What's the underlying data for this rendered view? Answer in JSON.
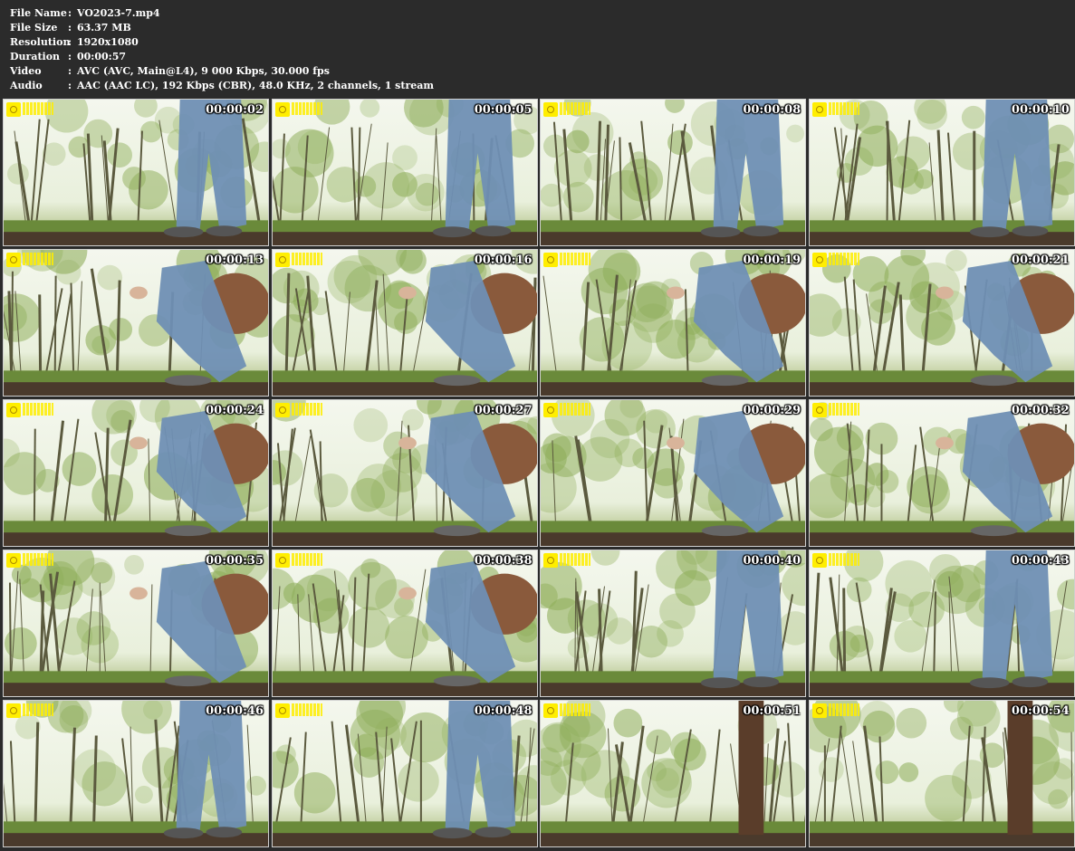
{
  "info": {
    "rows": [
      {
        "label": "File Name",
        "value": "VO2023-7.mp4"
      },
      {
        "label": "File Size",
        "value": "63.37 MB"
      },
      {
        "label": "Resolution",
        "value": "1920x1080"
      },
      {
        "label": "Duration",
        "value": "00:00:57"
      },
      {
        "label": "Video",
        "value": "AVC (AVC, Main@L4), 9 000 Kbps, 30.000 fps"
      },
      {
        "label": "Audio",
        "value": "AAC (AAC LC), 192 Kbps (CBR), 48.0 KHz, 2 channels, 1 stream"
      }
    ],
    "separator": ":"
  },
  "thumbnails": [
    {
      "time": "00:00:02",
      "scene": "standing"
    },
    {
      "time": "00:00:05",
      "scene": "standing"
    },
    {
      "time": "00:00:08",
      "scene": "standing"
    },
    {
      "time": "00:00:10",
      "scene": "standing"
    },
    {
      "time": "00:00:13",
      "scene": "squat"
    },
    {
      "time": "00:00:16",
      "scene": "squat"
    },
    {
      "time": "00:00:19",
      "scene": "squat"
    },
    {
      "time": "00:00:21",
      "scene": "squat"
    },
    {
      "time": "00:00:24",
      "scene": "squat"
    },
    {
      "time": "00:00:27",
      "scene": "squat"
    },
    {
      "time": "00:00:29",
      "scene": "squat"
    },
    {
      "time": "00:00:32",
      "scene": "squat"
    },
    {
      "time": "00:00:35",
      "scene": "squat"
    },
    {
      "time": "00:00:38",
      "scene": "squat"
    },
    {
      "time": "00:00:40",
      "scene": "standing"
    },
    {
      "time": "00:00:43",
      "scene": "standing"
    },
    {
      "time": "00:00:46",
      "scene": "standing"
    },
    {
      "time": "00:00:48",
      "scene": "standing"
    },
    {
      "time": "00:00:51",
      "scene": "forest"
    },
    {
      "time": "00:00:54",
      "scene": "forest"
    }
  ],
  "colors": {
    "background": "#2b2b2b",
    "sky": "#e9f0dc",
    "foliage": "#8fae5a",
    "ground": "#4a3a2c",
    "jeans": "#6f8fb4",
    "logo": "#ffee00"
  }
}
